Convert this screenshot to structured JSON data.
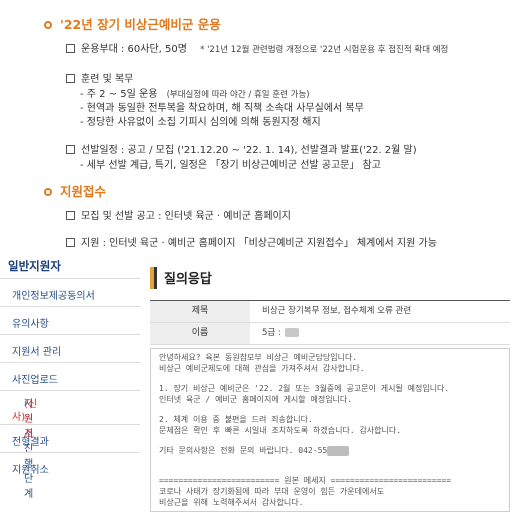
{
  "top": {
    "section1_title": "'22년 장기 비상근예비군 운용",
    "l1": "운용부대 : 60사단, 50명",
    "l1_note": "* '21년 12월 관련법령 개정으로 '22년 시험운용 후 점진적 확대 예정",
    "l2": "훈련 및 복무",
    "l3a": "- 주 2 ~ 5일 운용",
    "l3b": "(부대실정에 따라 야간 / 휴일 훈련 가능)",
    "l4": "- 현역과 동일한 전투복을 착요하며, 해 직책 소속대 사무실에서 복무",
    "l5": "- 정당한 사유없이 소집 기피시 심의에 의해 동원지정 해지",
    "l6": "선발일정 : 공고 / 모집 ('21.12.20 ~ '22. 1. 14), 선발결과 발표('22. 2월 말)",
    "l7": "- 세부 선발 계급, 특기, 일정은 「장기 비상근예비군 선발 공고문」 참고",
    "section2_title": "지원접수",
    "l8": "모집 및 선발 공고 : 인터넷 육군 · 예비군 홈페이지",
    "l9": "지원 : 인터넷 육군 · 예비군 홈페이지 「비상근예비군 지원접수」 체계에서 지원 가능"
  },
  "sidebar": {
    "title": "일반지원자",
    "items": [
      "개인정보제공동의서",
      "유의사항",
      "지원서 관리",
      "사진업로드",
      "지원서진행단계",
      "(신원조",
      "사)",
      "전형결과",
      "지원취소"
    ]
  },
  "qa": {
    "title": "질의응답",
    "subject_label": "제목",
    "subject_value": "비상근 장기복무 정보, 접수체계 오류 관련",
    "name_label": "이름",
    "name_value": "5급 :",
    "answer": [
      "안녕하세요? 육본 동원참모부 비상근 예비군담당입니다.",
      "비상근 예비군제도에 대해 관심을 가져주셔서 감사합니다.",
      "1. 장기 비상근 예비군은 '22. 2월 또는 3월중에 공고문이 게시될 예정입니다.",
      "인터넷 육군 / 예비군 홈페이지에 게시할 예정입니다.",
      "2. 체계 이용 중 불편을 드려 죄송합니다.",
      "문제점은 확인 후 빠른 시일내 조치하도록 하겠습니다. 감사합니다.",
      "기타 문의사항은 전화 문의 바랍니다. 042-55",
      "========================= 원본 메세지 =========================",
      "코로나 사태가 장기화됨에 따라 부대 운영이 힘든 가운데에서도",
      "비상근을 위해 노력해주셔서 감사합니다."
    ]
  },
  "colors": {
    "accent": "#e07a1f",
    "link": "#2a4f8a",
    "highlight": "#d32f2f"
  }
}
